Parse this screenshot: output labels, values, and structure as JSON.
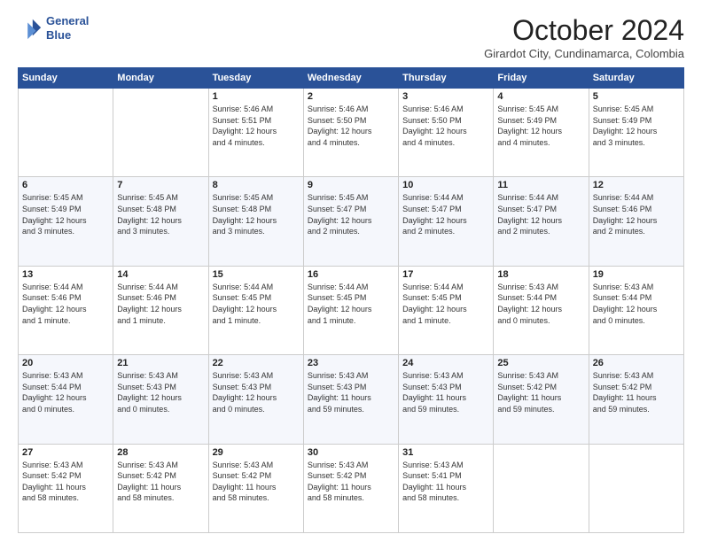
{
  "header": {
    "logo_line1": "General",
    "logo_line2": "Blue",
    "title": "October 2024",
    "location": "Girardot City, Cundinamarca, Colombia"
  },
  "days_of_week": [
    "Sunday",
    "Monday",
    "Tuesday",
    "Wednesday",
    "Thursday",
    "Friday",
    "Saturday"
  ],
  "weeks": [
    [
      {
        "day": "",
        "text": ""
      },
      {
        "day": "",
        "text": ""
      },
      {
        "day": "1",
        "text": "Sunrise: 5:46 AM\nSunset: 5:51 PM\nDaylight: 12 hours\nand 4 minutes."
      },
      {
        "day": "2",
        "text": "Sunrise: 5:46 AM\nSunset: 5:50 PM\nDaylight: 12 hours\nand 4 minutes."
      },
      {
        "day": "3",
        "text": "Sunrise: 5:46 AM\nSunset: 5:50 PM\nDaylight: 12 hours\nand 4 minutes."
      },
      {
        "day": "4",
        "text": "Sunrise: 5:45 AM\nSunset: 5:49 PM\nDaylight: 12 hours\nand 4 minutes."
      },
      {
        "day": "5",
        "text": "Sunrise: 5:45 AM\nSunset: 5:49 PM\nDaylight: 12 hours\nand 3 minutes."
      }
    ],
    [
      {
        "day": "6",
        "text": "Sunrise: 5:45 AM\nSunset: 5:49 PM\nDaylight: 12 hours\nand 3 minutes."
      },
      {
        "day": "7",
        "text": "Sunrise: 5:45 AM\nSunset: 5:48 PM\nDaylight: 12 hours\nand 3 minutes."
      },
      {
        "day": "8",
        "text": "Sunrise: 5:45 AM\nSunset: 5:48 PM\nDaylight: 12 hours\nand 3 minutes."
      },
      {
        "day": "9",
        "text": "Sunrise: 5:45 AM\nSunset: 5:47 PM\nDaylight: 12 hours\nand 2 minutes."
      },
      {
        "day": "10",
        "text": "Sunrise: 5:44 AM\nSunset: 5:47 PM\nDaylight: 12 hours\nand 2 minutes."
      },
      {
        "day": "11",
        "text": "Sunrise: 5:44 AM\nSunset: 5:47 PM\nDaylight: 12 hours\nand 2 minutes."
      },
      {
        "day": "12",
        "text": "Sunrise: 5:44 AM\nSunset: 5:46 PM\nDaylight: 12 hours\nand 2 minutes."
      }
    ],
    [
      {
        "day": "13",
        "text": "Sunrise: 5:44 AM\nSunset: 5:46 PM\nDaylight: 12 hours\nand 1 minute."
      },
      {
        "day": "14",
        "text": "Sunrise: 5:44 AM\nSunset: 5:46 PM\nDaylight: 12 hours\nand 1 minute."
      },
      {
        "day": "15",
        "text": "Sunrise: 5:44 AM\nSunset: 5:45 PM\nDaylight: 12 hours\nand 1 minute."
      },
      {
        "day": "16",
        "text": "Sunrise: 5:44 AM\nSunset: 5:45 PM\nDaylight: 12 hours\nand 1 minute."
      },
      {
        "day": "17",
        "text": "Sunrise: 5:44 AM\nSunset: 5:45 PM\nDaylight: 12 hours\nand 1 minute."
      },
      {
        "day": "18",
        "text": "Sunrise: 5:43 AM\nSunset: 5:44 PM\nDaylight: 12 hours\nand 0 minutes."
      },
      {
        "day": "19",
        "text": "Sunrise: 5:43 AM\nSunset: 5:44 PM\nDaylight: 12 hours\nand 0 minutes."
      }
    ],
    [
      {
        "day": "20",
        "text": "Sunrise: 5:43 AM\nSunset: 5:44 PM\nDaylight: 12 hours\nand 0 minutes."
      },
      {
        "day": "21",
        "text": "Sunrise: 5:43 AM\nSunset: 5:43 PM\nDaylight: 12 hours\nand 0 minutes."
      },
      {
        "day": "22",
        "text": "Sunrise: 5:43 AM\nSunset: 5:43 PM\nDaylight: 12 hours\nand 0 minutes."
      },
      {
        "day": "23",
        "text": "Sunrise: 5:43 AM\nSunset: 5:43 PM\nDaylight: 11 hours\nand 59 minutes."
      },
      {
        "day": "24",
        "text": "Sunrise: 5:43 AM\nSunset: 5:43 PM\nDaylight: 11 hours\nand 59 minutes."
      },
      {
        "day": "25",
        "text": "Sunrise: 5:43 AM\nSunset: 5:42 PM\nDaylight: 11 hours\nand 59 minutes."
      },
      {
        "day": "26",
        "text": "Sunrise: 5:43 AM\nSunset: 5:42 PM\nDaylight: 11 hours\nand 59 minutes."
      }
    ],
    [
      {
        "day": "27",
        "text": "Sunrise: 5:43 AM\nSunset: 5:42 PM\nDaylight: 11 hours\nand 58 minutes."
      },
      {
        "day": "28",
        "text": "Sunrise: 5:43 AM\nSunset: 5:42 PM\nDaylight: 11 hours\nand 58 minutes."
      },
      {
        "day": "29",
        "text": "Sunrise: 5:43 AM\nSunset: 5:42 PM\nDaylight: 11 hours\nand 58 minutes."
      },
      {
        "day": "30",
        "text": "Sunrise: 5:43 AM\nSunset: 5:42 PM\nDaylight: 11 hours\nand 58 minutes."
      },
      {
        "day": "31",
        "text": "Sunrise: 5:43 AM\nSunset: 5:41 PM\nDaylight: 11 hours\nand 58 minutes."
      },
      {
        "day": "",
        "text": ""
      },
      {
        "day": "",
        "text": ""
      }
    ]
  ]
}
